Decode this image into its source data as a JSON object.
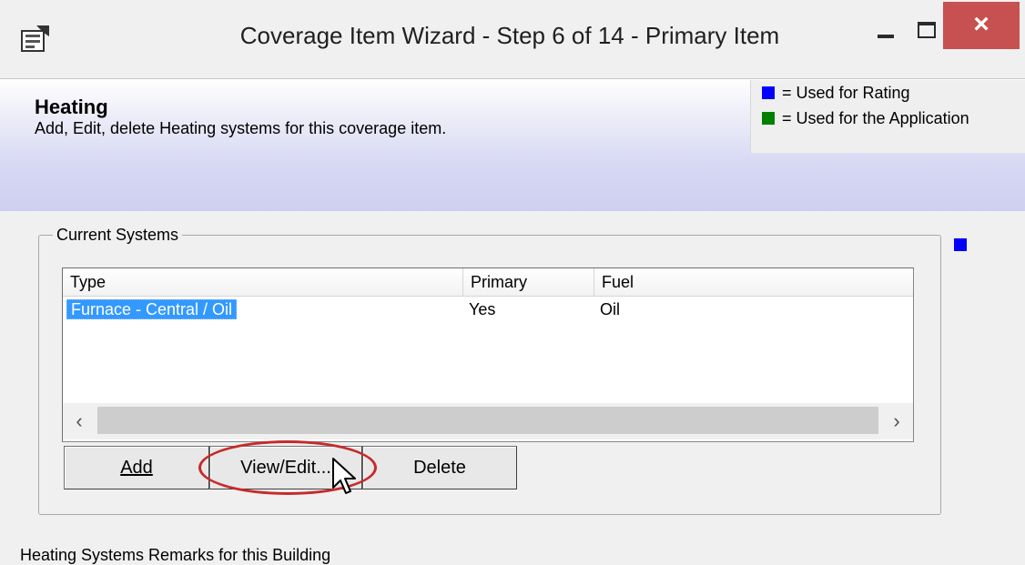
{
  "window": {
    "title": "Coverage Item Wizard - Step 6 of 14 - Primary Item",
    "icon": "wizard-window-icon",
    "close_color": "#c75050"
  },
  "header": {
    "title": "Heating",
    "subtitle": "Add, Edit, delete Heating systems for this coverage item."
  },
  "legend": {
    "rating_label": "= Used for Rating",
    "rating_color": "#0000ff",
    "application_label": "= Used for the Application",
    "application_color": "#008000"
  },
  "current_systems": {
    "label": "Current Systems",
    "columns": [
      "Type",
      "Primary",
      "Fuel"
    ],
    "rows": [
      {
        "type": "Furnace - Central / Oil",
        "primary": "Yes",
        "fuel": "Oil",
        "selected": true
      }
    ]
  },
  "buttons": {
    "add": "Add",
    "view_edit": "View/Edit...",
    "delete": "Delete"
  },
  "remarks_label": "Heating Systems Remarks for this Building"
}
